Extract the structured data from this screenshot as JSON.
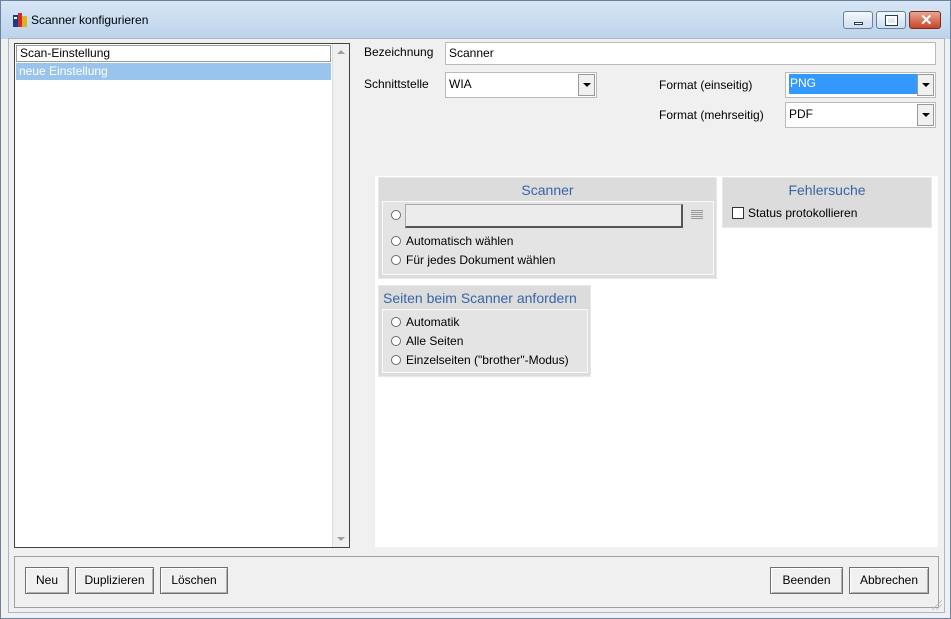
{
  "window": {
    "title": "Scanner konfigurieren"
  },
  "settings_list": {
    "header": "Scan-Einstellung",
    "items": [
      "neue Einstellung"
    ]
  },
  "form": {
    "bezeichnung_label": "Bezeichnung",
    "bezeichnung_value": "Scanner",
    "schnittstelle_label": "Schnittstelle",
    "schnittstelle_value": "WIA",
    "format_einseitig_label": "Format (einseitig)",
    "format_einseitig_value": "PNG",
    "format_mehrseitig_label": "Format (mehrseitig)",
    "format_mehrseitig_value": "PDF"
  },
  "scanner_group": {
    "title": "Scanner",
    "option_auto": "Automatisch wählen",
    "option_each": "Für jedes Dokument wählen"
  },
  "pages_group": {
    "title": "Seiten beim Scanner anfordern",
    "options": [
      "Automatik",
      "Alle Seiten",
      "Einzelseiten (\"brother\"-Modus)"
    ]
  },
  "debug_group": {
    "title": "Fehlersuche",
    "log_status": "Status protokollieren"
  },
  "buttons": {
    "new": "Neu",
    "duplicate": "Duplizieren",
    "delete": "Löschen",
    "finish": "Beenden",
    "cancel": "Abbrechen"
  },
  "colors": {
    "selection": "#3399ff",
    "list_selection": "#99c4eb",
    "group_title": "#3765a6"
  }
}
